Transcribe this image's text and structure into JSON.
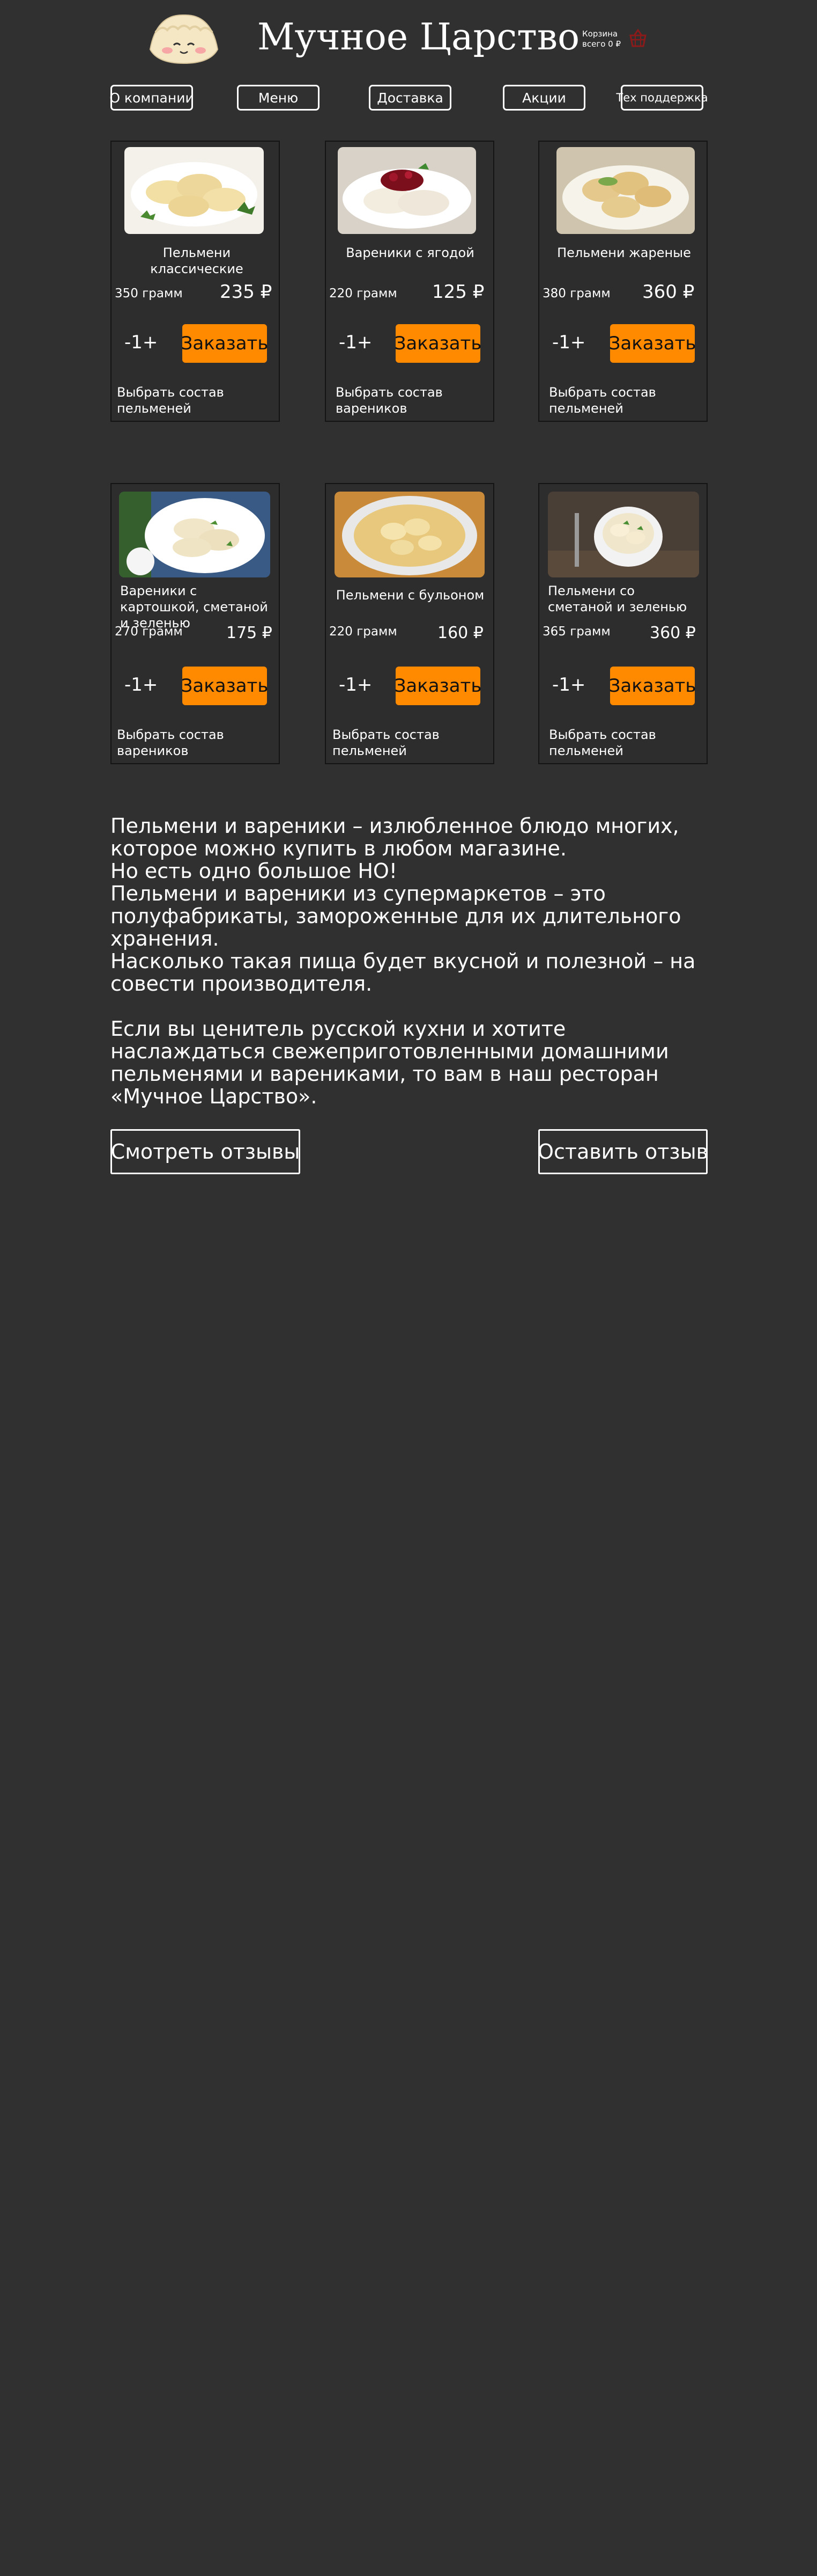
{
  "header": {
    "brand": "Мучное Царство",
    "cart_label": "Корзина",
    "cart_total": "всего 0 ₽",
    "logo_icon": "dumpling-logo-icon",
    "cart_icon": "shopping-basket-icon"
  },
  "nav": [
    {
      "label": "О компании"
    },
    {
      "label": "Меню"
    },
    {
      "label": "Доставка"
    },
    {
      "label": "Акции"
    },
    {
      "label": "Тех поддержка"
    }
  ],
  "products": [
    {
      "title": "Пельмени классические",
      "weight": "350 грамм",
      "price": "235  ₽",
      "stepper": "-1+",
      "order": "Заказать",
      "compose": "Выбрать состав пельменей",
      "image_icon": "dumplings-photo"
    },
    {
      "title": "Вареники с ягодой",
      "weight": "220 грамм",
      "price": "125  ₽",
      "stepper": "-1+",
      "order": "Заказать",
      "compose": "Выбрать состав вареников",
      "image_icon": "berry-vareniki-photo"
    },
    {
      "title": "Пельмени жареные",
      "weight": "380 грамм",
      "price": "360  ₽",
      "stepper": "-1+",
      "order": "Заказать",
      "compose": "Выбрать состав пельменей",
      "image_icon": "fried-dumplings-photo"
    },
    {
      "title": "Вареники с картошкой, сметаной и зеленью",
      "weight": "270 грамм",
      "price": "175  ₽",
      "stepper": "-1+",
      "order": "Заказать",
      "compose": "Выбрать состав вареников",
      "image_icon": "potato-vareniki-photo"
    },
    {
      "title": "Пельмени с бульоном",
      "weight": "220 грамм",
      "price": "160  ₽",
      "stepper": "-1+",
      "order": "Заказать",
      "compose": "Выбрать состав пельменей",
      "image_icon": "broth-dumplings-photo"
    },
    {
      "title": "Пельмени со сметаной и зеленью",
      "weight": "365 грамм",
      "price": "360  ₽",
      "stepper": "-1+",
      "order": "Заказать",
      "compose": "Выбрать состав пельменей",
      "image_icon": "sour-cream-dumplings-photo"
    }
  ],
  "about": {
    "p1": "Пельмени и вареники – излюбленное блюдо многих, которое можно купить в любом магазине.",
    "p2": "Но есть одно большое НО!",
    "p3": "Пельмени и вареники из супермаркетов – это полуфабрикаты, замороженные для их длительного хранения.",
    "p4": "Насколько такая пища будет вкусной и полезной – на совести производителя.",
    "p5": "Если вы ценитель русской кухни и хотите наслаждаться свежеприготовленными домашними пельменями и варениками, то вам в наш ресторан «Мучное Царство»."
  },
  "reviews": {
    "view": "Смотреть отзывы",
    "leave": "Оставить отзыв"
  },
  "colors": {
    "background": "#303030",
    "accent": "#ff8a00",
    "cart_icon": "#8b1a1a"
  }
}
